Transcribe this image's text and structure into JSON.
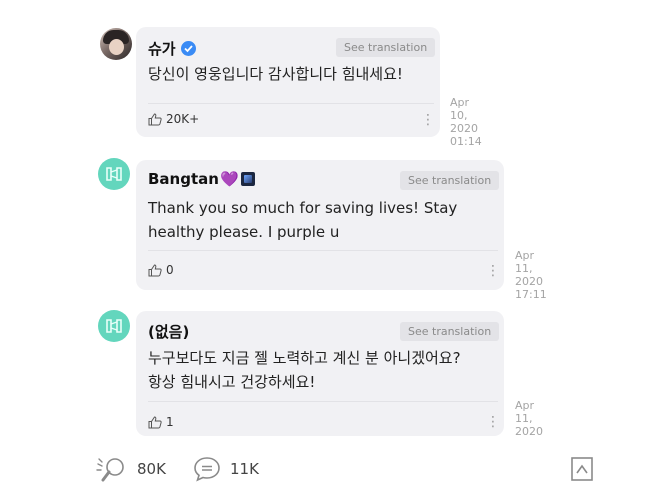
{
  "comments": [
    {
      "author": "슈가",
      "verified": true,
      "avatar": "user-photo-avatar",
      "translate_label": "See translation",
      "text": "당신이 영웅입니다 감사합니다 힘내세요!",
      "likes": "20K+",
      "date": "Apr 10,\n2020\n01:14"
    },
    {
      "author": "Bangtan",
      "author_emoji": "💜",
      "avatar": "bangtan-logo-avatar",
      "translate_label": "See translation",
      "text": "Thank you so much for saving lives! Stay\nhealthy please. I purple u",
      "likes": "0",
      "date": "Apr 11,\n2020\n17:11"
    },
    {
      "author": "(없음)",
      "avatar": "bangtan-logo-avatar",
      "translate_label": "See translation",
      "text": "누구보다도 지금 젤 노력하고 계신 분 아니겠어요?\n항상 힘내시고 건강하세요!",
      "likes": "1",
      "date": "Apr 11,\n2020"
    }
  ],
  "footer": {
    "likes_count": "80K",
    "comments_count": "11K"
  },
  "colors": {
    "bubble": "#f1f1f4",
    "verified": "#3a8bf5",
    "logo_teal": "#63d6bd",
    "heart": "#b154e6"
  }
}
